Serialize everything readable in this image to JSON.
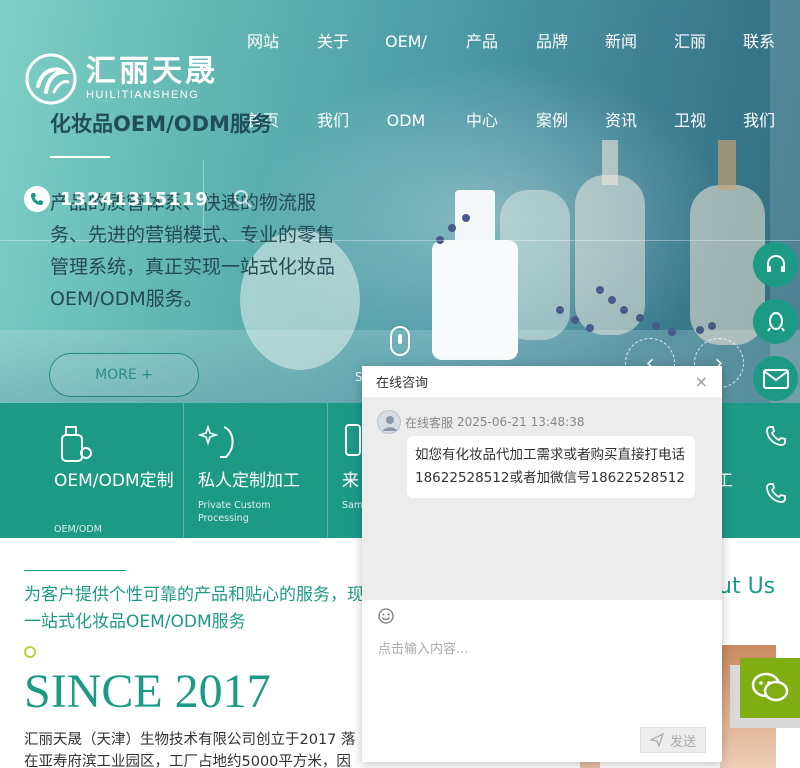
{
  "brand": {
    "name_cn": "汇丽天晟",
    "name_en": "HUILITIANSHENG"
  },
  "nav": [
    {
      "top": "网站",
      "bottom": "首页"
    },
    {
      "top": "关于",
      "bottom": "我们"
    },
    {
      "top": "OEM/",
      "bottom": "ODM"
    },
    {
      "top": "产品",
      "bottom": "中心"
    },
    {
      "top": "品牌",
      "bottom": "案例"
    },
    {
      "top": "新闻",
      "bottom": "资讯"
    },
    {
      "top": "汇丽",
      "bottom": "卫视"
    },
    {
      "top": "联系",
      "bottom": "我们"
    }
  ],
  "hero": {
    "title": "化妆品OEM/ODM服务",
    "description": "产品的质管体系、快速的物流服务、先进的营销模式、专业的零售管理系统，真正实现一站式化妆品OEM/ODM服务。",
    "phone": "13241315119",
    "more_label": "MORE +",
    "scroll_label": "S"
  },
  "services": [
    {
      "title": "OEM/ODM定制",
      "sub": "OEM/ODM",
      "icon": "bottle-icon"
    },
    {
      "title": "私人定制加工",
      "sub": "Private Custom Processing",
      "icon": "sparkle-face-icon"
    },
    {
      "title": "来",
      "sub": "Sam ng",
      "icon": "tube-icon"
    },
    {
      "title": "",
      "sub": "",
      "icon": ""
    },
    {
      "title": "工",
      "sub": "",
      "icon": ""
    }
  ],
  "about": {
    "lead": "为客户提供个性可靠的产品和贴心的服务，现一站式化妆品OEM/ODM服务",
    "since": "SINCE 2017",
    "body": "汇丽天晟（天津）生物技术有限公司创立于2017 落在亚寿府滨工业园区，工厂占地约5000平方米，因地有实占",
    "about_us": "ut Us"
  },
  "chat": {
    "title": "在线咨询",
    "close": "×",
    "agent": "在线客服",
    "timestamp": "2025-06-21 13:48:38",
    "message": "如您有化妆品代加工需求或者购买直接打电话18622528512或者加微信号18622528512",
    "input_placeholder": "点击输入内容...",
    "send_label": "发送"
  },
  "colors": {
    "primary": "#1d9a86",
    "accent": "#b7d433",
    "wechat": "#7fae12"
  }
}
